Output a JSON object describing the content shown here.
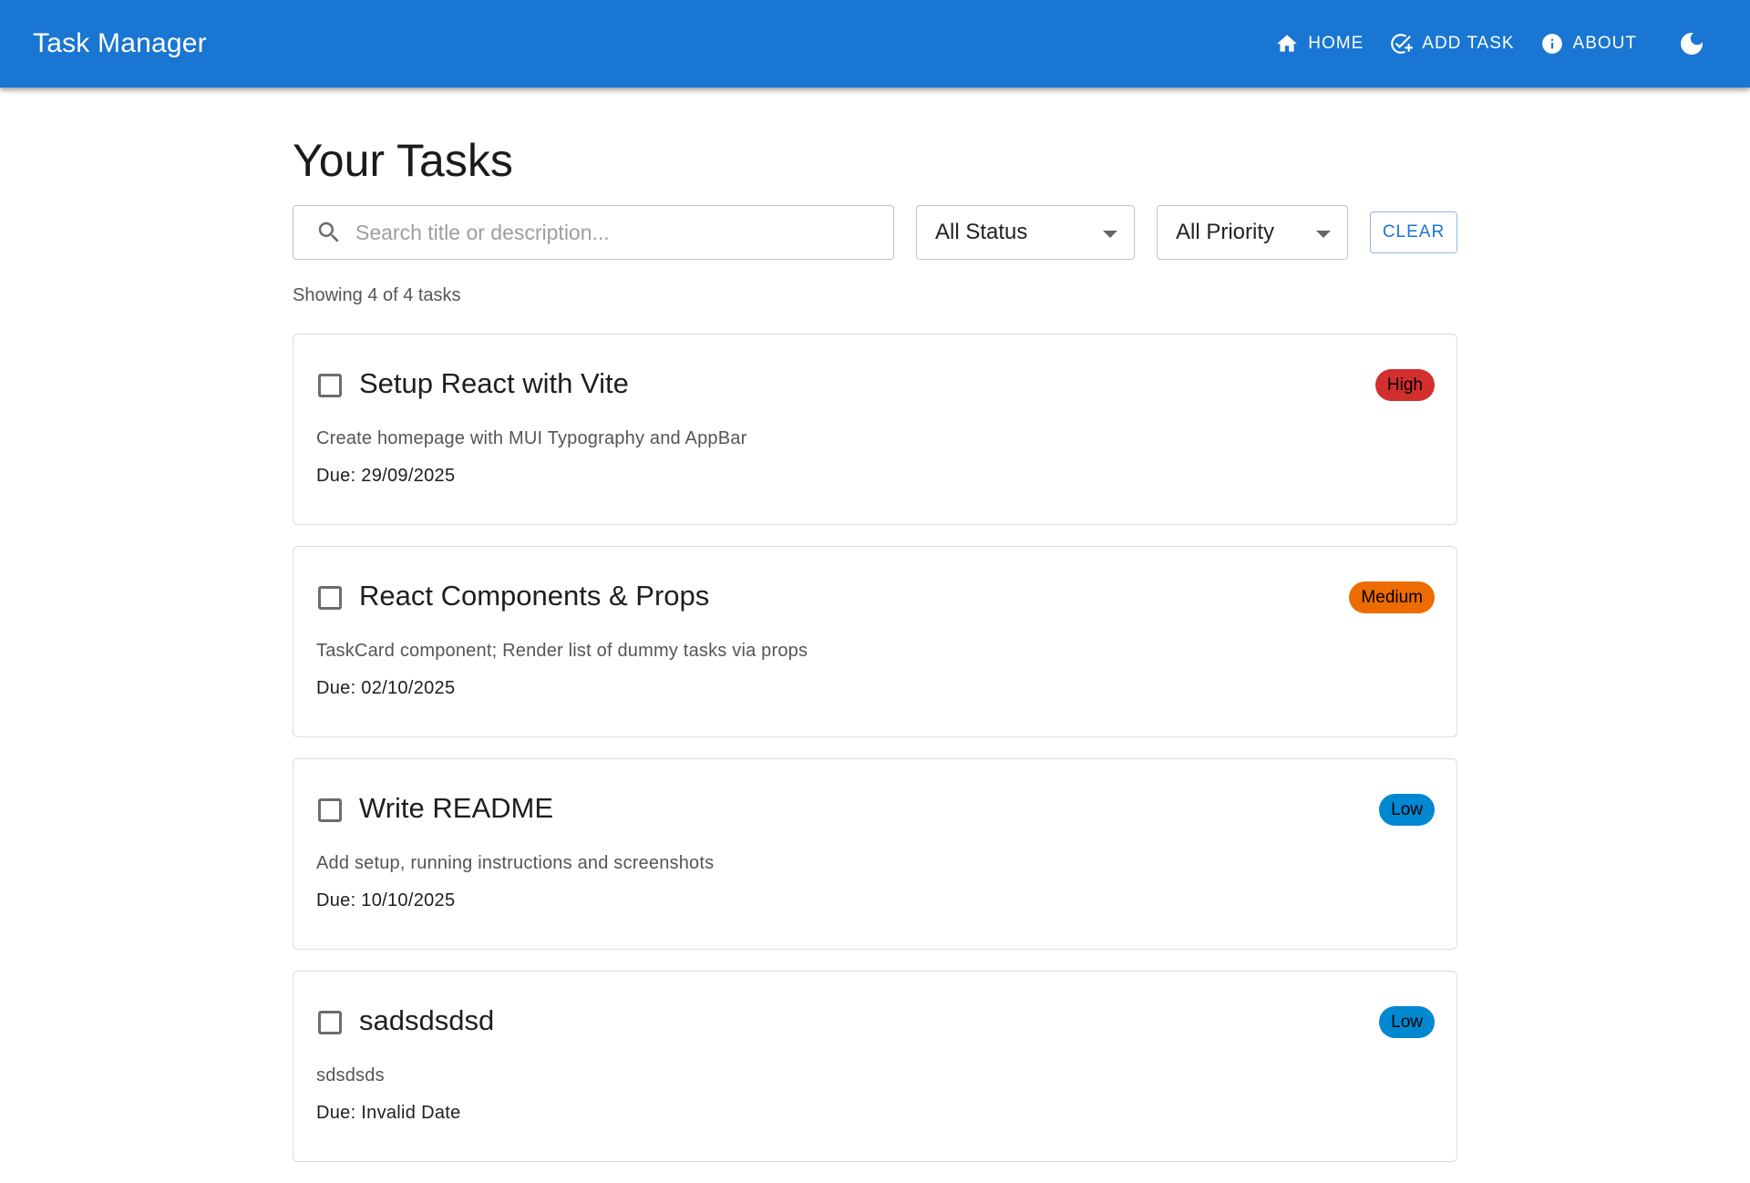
{
  "app": {
    "title": "Task Manager"
  },
  "nav": {
    "home_label": "HOME",
    "add_task_label": "ADD TASK",
    "about_label": "ABOUT"
  },
  "page": {
    "title": "Your Tasks"
  },
  "filters": {
    "search_placeholder": "Search title or description...",
    "status_value": "All Status",
    "priority_value": "All Priority",
    "clear_label": "CLEAR"
  },
  "summary": {
    "count_text": "Showing 4 of 4 tasks"
  },
  "colors": {
    "appbar": "#1976d2",
    "priority_high": "#d32f2f",
    "priority_medium": "#ed6c02",
    "priority_low": "#0288d1"
  },
  "tasks": [
    {
      "title": "Setup React with Vite",
      "description": "Create homepage with MUI Typography and AppBar",
      "due": "Due: 29/09/2025",
      "priority": "High",
      "priority_color": "#d32f2f",
      "completed": false
    },
    {
      "title": "React Components & Props",
      "description": "TaskCard component; Render list of dummy tasks via props",
      "due": "Due: 02/10/2025",
      "priority": "Medium",
      "priority_color": "#ed6c02",
      "completed": false
    },
    {
      "title": "Write README",
      "description": "Add setup, running instructions and screenshots",
      "due": "Due: 10/10/2025",
      "priority": "Low",
      "priority_color": "#0288d1",
      "completed": false
    },
    {
      "title": "sadsdsdsd",
      "description": "sdsdsds",
      "due": "Due: Invalid Date",
      "priority": "Low",
      "priority_color": "#0288d1",
      "completed": false
    }
  ],
  "icons": {
    "home": "home-icon",
    "add_task": "add-task-icon",
    "about": "info-icon",
    "theme": "dark-mode-icon",
    "search": "search-icon"
  }
}
